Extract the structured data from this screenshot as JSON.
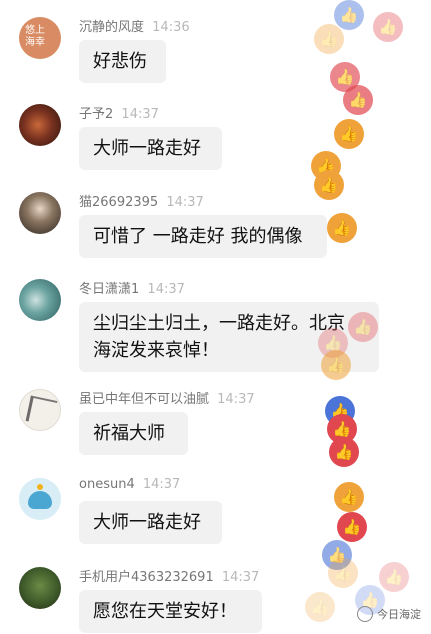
{
  "messages": [
    {
      "name": "沉静的风度",
      "time": "14:36",
      "text": "好悲伤"
    },
    {
      "name": "子予2",
      "time": "14:37",
      "text": "大师一路走好"
    },
    {
      "name": "猫26692395",
      "time": "14:37",
      "text": "可惜了 一路走好 我的偶像"
    },
    {
      "name": "冬日潇潇1",
      "time": "14:37",
      "text": "尘归尘土归土，一路走好。北京\n海淀发来哀悼！"
    },
    {
      "name": "虽已中年但不可以油腻",
      "time": "14:37",
      "text": "祈福大师"
    },
    {
      "name": "onesun4",
      "time": "14:37",
      "text": "大师一路走好"
    },
    {
      "name": "手机用户4363232691",
      "time": "14:37",
      "text": "愿您在天堂安好！"
    }
  ],
  "avatar_text": {
    "first": "悠上 海幸"
  },
  "watermark": {
    "label": "今日海淀"
  },
  "colors": {
    "like_orange": "#f0a23a",
    "like_red": "#e0474f",
    "like_blue": "#4a74d8"
  }
}
